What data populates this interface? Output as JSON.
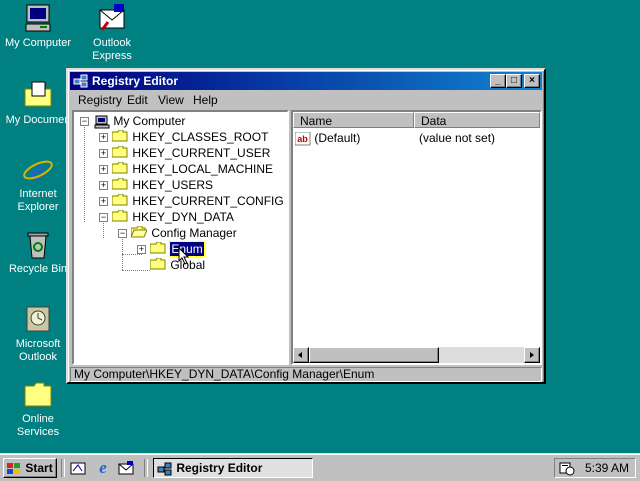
{
  "desktop": {
    "background": "#008080",
    "icons": [
      {
        "name": "My Computer",
        "icon": "computer-icon"
      },
      {
        "name": "Outlook\nExpress",
        "line1": "Outlook",
        "line2": "Express",
        "icon": "outlook-express-icon"
      },
      {
        "name": "My Documents",
        "label": "My Documen",
        "icon": "folder-icon"
      },
      {
        "name": "Internet Explorer",
        "line1": "Internet",
        "line2": "Explorer",
        "icon": "ie-icon"
      },
      {
        "name": "Recycle Bin",
        "label": "Recycle Bin",
        "icon": "recycle-bin-icon"
      },
      {
        "name": "Microsoft Outlook",
        "line1": "Microsoft",
        "line2": "Outlook",
        "icon": "outlook-icon"
      },
      {
        "name": "Online Services",
        "line1": "Online",
        "line2": "Services",
        "icon": "folder-icon"
      }
    ]
  },
  "window": {
    "title": "Registry Editor",
    "controls": {
      "minimize": "_",
      "maximize": "□",
      "close": "×"
    },
    "menu": [
      "Registry",
      "Edit",
      "View",
      "Help"
    ],
    "tree": {
      "root": "My Computer",
      "hkeys": [
        "HKEY_CLASSES_ROOT",
        "HKEY_CURRENT_USER",
        "HKEY_LOCAL_MACHINE",
        "HKEY_USERS",
        "HKEY_CURRENT_CONFIG",
        "HKEY_DYN_DATA"
      ],
      "config_manager": "Config Manager",
      "enum": "Enum",
      "global": "Global",
      "selected": "Enum"
    },
    "list": {
      "columns": [
        "Name",
        "Data"
      ],
      "rows": [
        {
          "name": "(Default)",
          "data": "(value not set)"
        }
      ]
    },
    "status": "My Computer\\HKEY_DYN_DATA\\Config Manager\\Enum"
  },
  "taskbar": {
    "start": "Start",
    "task": "Registry Editor",
    "clock": "5:39 AM"
  }
}
